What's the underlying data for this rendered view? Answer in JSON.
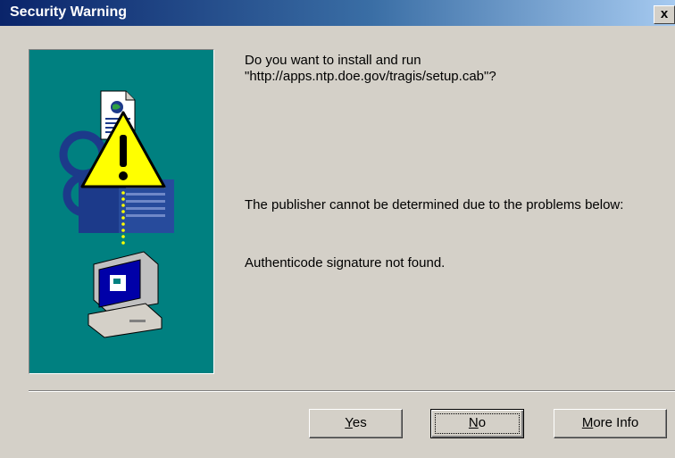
{
  "window": {
    "title": "Security Warning",
    "close_label": "x"
  },
  "message": {
    "question": "Do you want to install and run \"http://apps.ntp.doe.gov/tragis/setup.cab\"?",
    "publisher": "The publisher cannot be determined due to the problems below:",
    "authenticode": "Authenticode signature not found."
  },
  "buttons": {
    "yes_key": "Y",
    "yes_rest": "es",
    "no_key": "N",
    "no_rest": "o",
    "more_key": "M",
    "more_rest": "ore Info"
  },
  "icons": {
    "panel": [
      "document-icon",
      "warning-icon",
      "key-icon",
      "computer-icon"
    ]
  },
  "colors": {
    "titlebar_start": "#0a246a",
    "titlebar_end": "#a6caf0",
    "panel": "#008080",
    "dialog": "#d4d0c8",
    "warning": "#ffff00"
  }
}
